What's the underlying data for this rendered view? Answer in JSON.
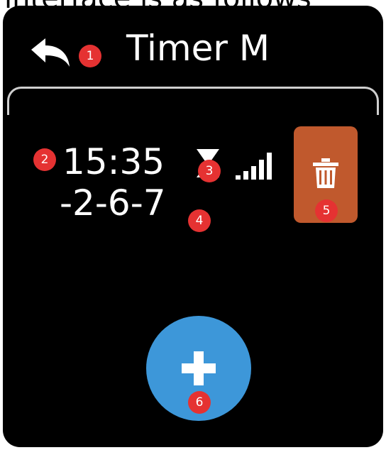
{
  "caption": "interface is as follows",
  "header": {
    "title": "Timer M"
  },
  "alarm": {
    "time": "15:35",
    "days": "-2-6-7"
  },
  "badges": [
    "1",
    "2",
    "3",
    "4",
    "5",
    "6"
  ],
  "colors": {
    "background": "#000000",
    "delete": "#c0592d",
    "add": "#3d97d9",
    "badge": "#e53232"
  },
  "icons": {
    "back": "back-arrow-icon",
    "timer": "hourglass-icon",
    "signal": "signal-bars-icon",
    "delete": "trash-icon",
    "add": "plus-icon"
  }
}
